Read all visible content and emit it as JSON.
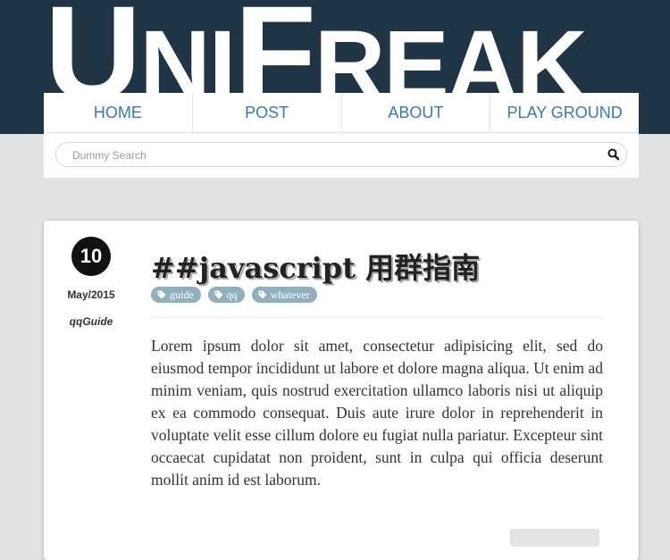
{
  "logo": {
    "letters": [
      "U",
      "NI",
      "F",
      "REAK"
    ]
  },
  "nav": {
    "items": [
      "HOME",
      "POST",
      "ABOUT",
      "PLAY GROUND"
    ]
  },
  "search": {
    "placeholder": "Dummy Search",
    "value": "",
    "icon": "search-icon"
  },
  "post": {
    "day": "10",
    "month": "May/2015",
    "category": "qqGuide",
    "title": "##javascript 用群指南",
    "tags": [
      {
        "label": "guide",
        "icon": "tag-icon"
      },
      {
        "label": "qq",
        "icon": "tag-icon"
      },
      {
        "label": "whatever",
        "icon": "tag-icon"
      }
    ],
    "body": "Lorem ipsum dolor sit amet, consectetur adipisicing elit, sed do eiusmod tempor incididunt ut labore et dolore magna aliqua. Ut enim ad minim veniam, quis nostrud exercitation ullamco laboris nisi ut aliquip ex ea commodo consequat. Duis aute irure dolor in reprehenderit in voluptate velit esse cillum dolore eu fugiat nulla pariatur. Excepteur sint occaecat cupidatat non proident, sunt in culpa qui officia deserunt mollit anim id est laborum."
  },
  "colors": {
    "banner": "#1f3444",
    "nav_link": "#3a78b5",
    "tag_bg": "#8fb0bf",
    "page_bg": "#e2e2e2"
  }
}
